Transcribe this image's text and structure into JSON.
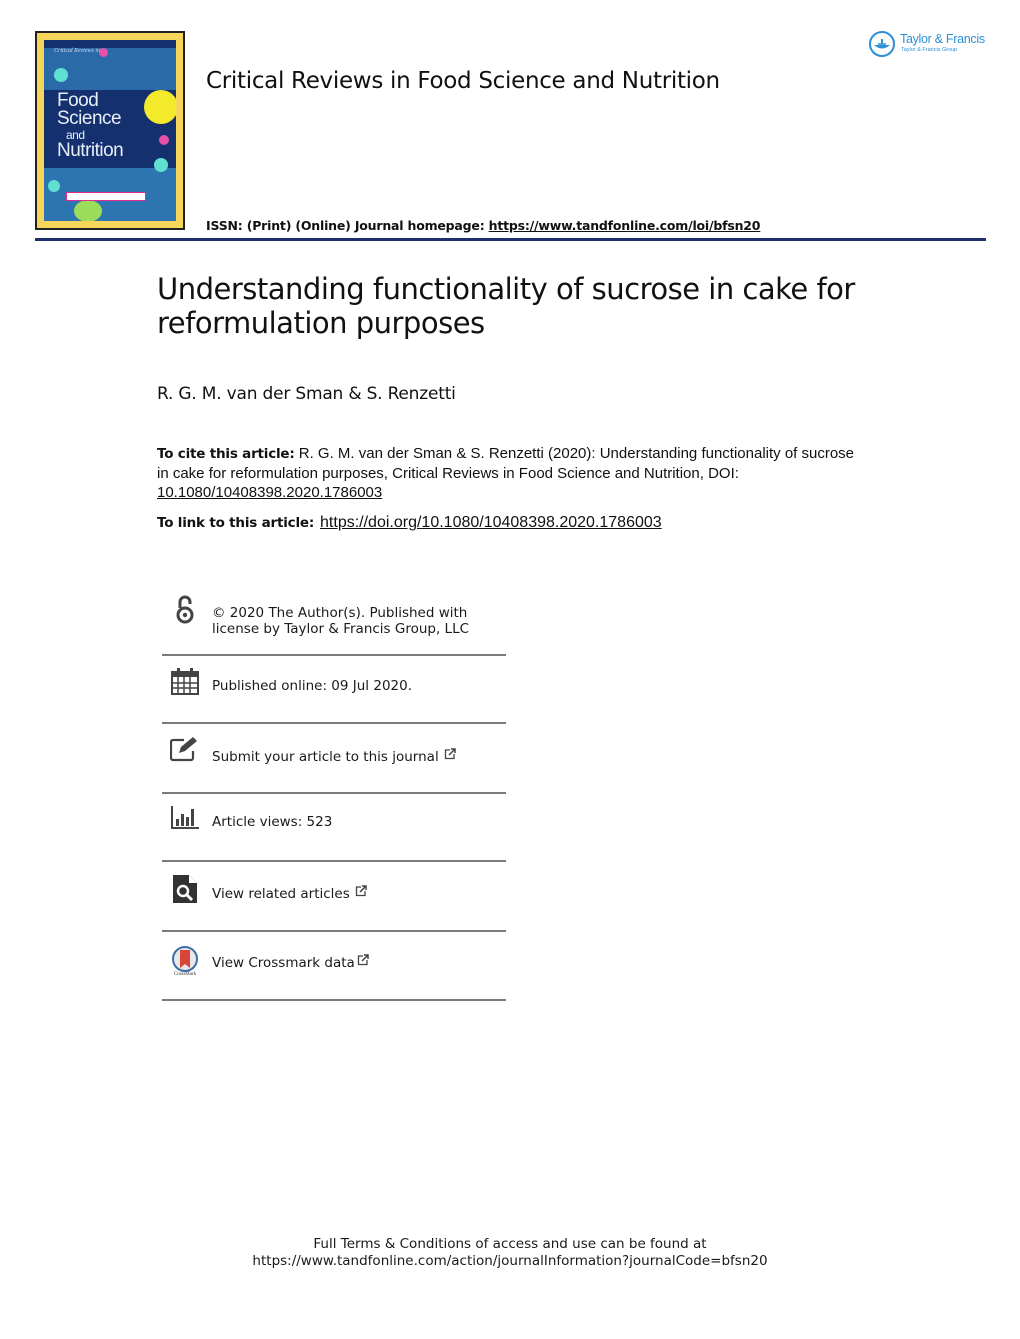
{
  "journal": {
    "title": "Critical Reviews in Food Science and Nutrition",
    "issn_line": "ISSN: (Print) (Online) Journal homepage: ",
    "homepage_url": "https://www.tandfonline.com/loi/bfsn20",
    "cover": {
      "line1": "Food",
      "line2": "Science",
      "line3": "and",
      "line4": "Nutrition",
      "small_caption": "Critical Reviews in"
    },
    "rule_color": "#1f2f6e"
  },
  "publisher": {
    "name": "Taylor & Francis",
    "group": "Taylor & Francis Group",
    "brand_color": "#2d8fd6"
  },
  "article": {
    "title": "Understanding functionality of sucrose in cake for reformulation purposes",
    "authors": "R. G. M. van der Sman & S. Renzetti",
    "cite_label": "To cite this article:",
    "cite_text": " R. G. M. van der Sman & S. Renzetti (2020): Understanding functionality of sucrose in cake for reformulation purposes, Critical Reviews in Food Science and Nutrition, DOI: ",
    "cite_doi": "10.1080/10408398.2020.1786003",
    "link_label": "To link to this article:",
    "link_url": "https://doi.org/10.1080/10408398.2020.1786003"
  },
  "info_items": [
    {
      "icon": "open-access-icon",
      "text_line1": "© 2020 The Author(s). Published with",
      "text_line2": "license by Taylor & Francis Group, LLC"
    },
    {
      "icon": "calendar-icon",
      "text": "Published online: 09 Jul 2020."
    },
    {
      "icon": "edit-icon",
      "text": "Submit your article to this journal",
      "external": true
    },
    {
      "icon": "bar-chart-icon",
      "text": "Article views: 523"
    },
    {
      "icon": "search-document-icon",
      "text": "View related articles",
      "external": true
    },
    {
      "icon": "crossmark-icon",
      "text": "View Crossmark data",
      "external": true,
      "icon_caption": "CrossMark"
    }
  ],
  "footer": {
    "line1": "Full Terms & Conditions of access and use can be found at",
    "line2": "https://www.tandfonline.com/action/journalInformation?journalCode=bfsn20"
  }
}
